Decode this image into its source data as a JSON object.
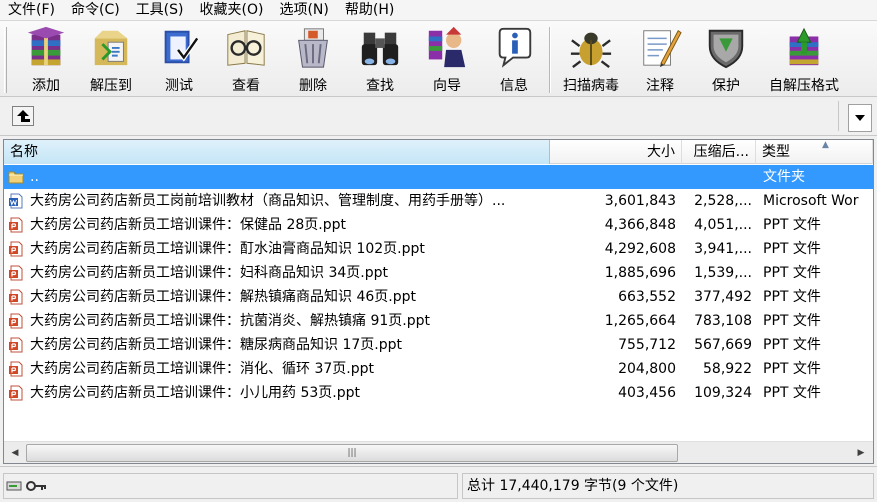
{
  "menu": [
    "文件(F)",
    "命令(C)",
    "工具(S)",
    "收藏夹(O)",
    "选项(N)",
    "帮助(H)"
  ],
  "toolbar": [
    {
      "label": "添加",
      "icon": "add-archive-icon"
    },
    {
      "label": "解压到",
      "icon": "extract-to-icon"
    },
    {
      "label": "测试",
      "icon": "test-archive-icon"
    },
    {
      "label": "查看",
      "icon": "view-file-icon"
    },
    {
      "label": "删除",
      "icon": "delete-icon"
    },
    {
      "label": "查找",
      "icon": "find-binoculars-icon"
    },
    {
      "label": "向导",
      "icon": "wizard-icon"
    },
    {
      "label": "信息",
      "icon": "info-icon"
    },
    {
      "label": "扫描病毒",
      "icon": "virus-scan-icon"
    },
    {
      "label": "注释",
      "icon": "comment-icon"
    },
    {
      "label": "保护",
      "icon": "protect-shield-icon"
    },
    {
      "label": "自解压格式",
      "icon": "sfx-icon"
    }
  ],
  "columns": {
    "name": "名称",
    "size": "大小",
    "packed": "压缩后...",
    "type": "类型"
  },
  "rows": [
    {
      "name": "..",
      "size": "",
      "packed": "",
      "type": "文件夹",
      "icon": "folder-up-icon",
      "selected": true
    },
    {
      "name": "大药房公司药店新员工岗前培训教材（商品知识、管理制度、用药手册等）...",
      "size": "3,601,843",
      "packed": "2,528,...",
      "type": "Microsoft Wor",
      "icon": "word-doc-icon"
    },
    {
      "name": "大药房公司药店新员工培训课件：保健品  28页.ppt",
      "size": "4,366,848",
      "packed": "4,051,...",
      "type": "PPT 文件",
      "icon": "ppt-file-icon"
    },
    {
      "name": "大药房公司药店新员工培训课件：酊水油膏商品知识 102页.ppt",
      "size": "4,292,608",
      "packed": "3,941,...",
      "type": "PPT 文件",
      "icon": "ppt-file-icon"
    },
    {
      "name": "大药房公司药店新员工培训课件：妇科商品知识 34页.ppt",
      "size": "1,885,696",
      "packed": "1,539,...",
      "type": "PPT 文件",
      "icon": "ppt-file-icon"
    },
    {
      "name": "大药房公司药店新员工培训课件：解热镇痛商品知识 46页.ppt",
      "size": "663,552",
      "packed": "377,492",
      "type": "PPT 文件",
      "icon": "ppt-file-icon"
    },
    {
      "name": "大药房公司药店新员工培训课件：抗菌消炎、解热镇痛  91页.ppt",
      "size": "1,265,664",
      "packed": "783,108",
      "type": "PPT 文件",
      "icon": "ppt-file-icon"
    },
    {
      "name": "大药房公司药店新员工培训课件：糖尿病商品知识 17页.ppt",
      "size": "755,712",
      "packed": "567,669",
      "type": "PPT 文件",
      "icon": "ppt-file-icon"
    },
    {
      "name": "大药房公司药店新员工培训课件：消化、循环 37页.ppt",
      "size": "204,800",
      "packed": "58,922",
      "type": "PPT 文件",
      "icon": "ppt-file-icon"
    },
    {
      "name": "大药房公司药店新员工培训课件：小儿用药  53页.ppt",
      "size": "403,456",
      "packed": "109,324",
      "type": "PPT 文件",
      "icon": "ppt-file-icon"
    }
  ],
  "status": {
    "summary": "总计 17,440,179 字节(9 个文件)"
  },
  "colors": {
    "selection": "#3399ff",
    "header_active": "#c4e5f6"
  }
}
